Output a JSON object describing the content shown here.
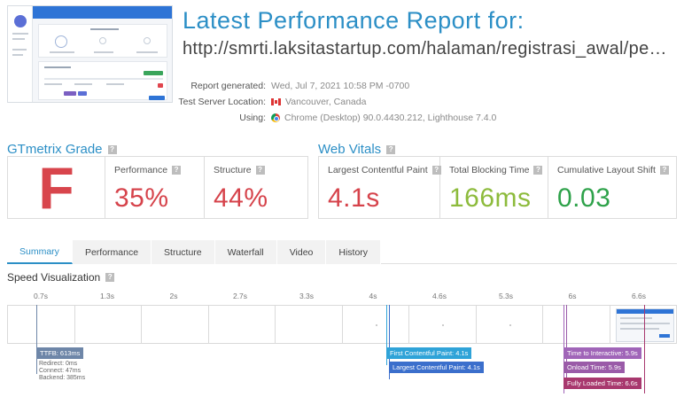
{
  "header": {
    "title": "Latest Performance Report for:",
    "url": "http://smrti.laksitastartup.com/halaman/registrasi_awal/pemili..."
  },
  "meta": {
    "generated_label": "Report generated:",
    "generated_value": "Wed, Jul 7, 2021 10:58 PM -0700",
    "location_label": "Test Server Location:",
    "location_value": "Vancouver, Canada",
    "using_label": "Using:",
    "using_value": "Chrome (Desktop) 90.0.4430.212, Lighthouse 7.4.0",
    "icons": [
      "canada-flag-icon",
      "chrome-icon"
    ]
  },
  "grade": {
    "heading": "GTmetrix Grade",
    "letter": "F",
    "performance_label": "Performance",
    "performance_value": "35%",
    "structure_label": "Structure",
    "structure_value": "44%"
  },
  "vitals": {
    "heading": "Web Vitals",
    "lcp_label": "Largest Contentful Paint",
    "lcp_value": "4.1s",
    "tbt_label": "Total Blocking Time",
    "tbt_value": "166ms",
    "cls_label": "Cumulative Layout Shift",
    "cls_value": "0.03"
  },
  "tabs": [
    "Summary",
    "Performance",
    "Structure",
    "Waterfall",
    "Video",
    "History"
  ],
  "active_tab": "Summary",
  "speed": {
    "heading": "Speed Visualization",
    "ticks": [
      "0.7s",
      "1.3s",
      "2s",
      "2.7s",
      "3.3s",
      "4s",
      "4.6s",
      "5.3s",
      "6s",
      "6.6s"
    ],
    "ttfb_label": "TTFB: 613ms",
    "ttfb_details": [
      "Redirect: 0ms",
      "Connect: 47ms",
      "Backend: 385ms"
    ],
    "fcp_label": "First Contentful Paint: 4.1s",
    "lcp_label": "Largest Contentful Paint: 4.1s",
    "tti_label": "Time to Interactive: 5.9s",
    "onload_label": "Onload Time: 5.9s",
    "fully_loaded_label": "Fully Loaded Time: 6.6s"
  },
  "colors": {
    "accent": "#2c8fc6",
    "grade_f": "#d6434b",
    "ttfb": "#6e86a8",
    "fcp": "#2fa3d8",
    "lcp": "#3b6fcc",
    "tti": "#a065b8",
    "onload": "#9a5ba8",
    "fully_loaded": "#a8386e"
  }
}
